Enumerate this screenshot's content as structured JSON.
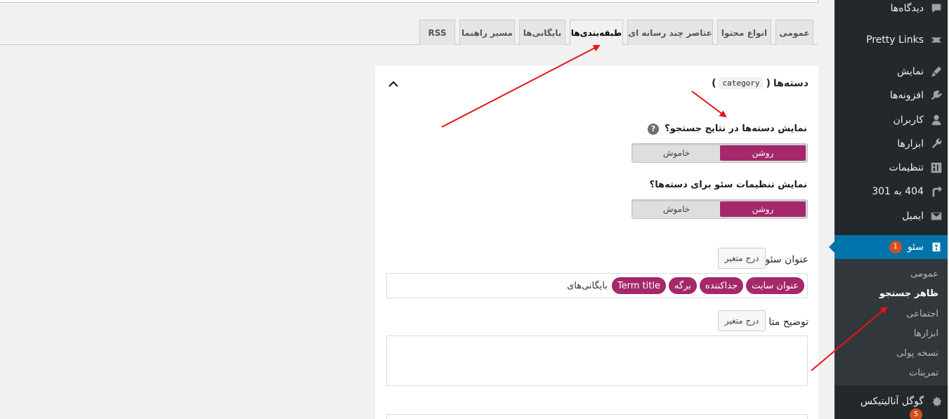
{
  "tabs": [
    {
      "label": "عمومی",
      "active": false
    },
    {
      "label": "انواع محتوا",
      "active": false
    },
    {
      "label": "عناصر چند رسانه ای",
      "active": false
    },
    {
      "label": "طبقه‌بندی‌ها",
      "active": true
    },
    {
      "label": "بایگانی‌ها",
      "active": false
    },
    {
      "label": "مسیر راهنما",
      "active": false
    },
    {
      "label": "RSS",
      "active": false
    }
  ],
  "panel": {
    "title": "دسته‌ها",
    "taxonomy_slug": "category",
    "show_in_search": {
      "label": "نمایش دسته‌ها در نتایج جستجو؟",
      "help": "?",
      "on_label": "روشن",
      "off_label": "خاموش",
      "value": "on"
    },
    "show_seo_settings": {
      "label": "نمایش تنظیمات سئو برای دسته‌ها؟",
      "on_label": "روشن",
      "off_label": "خاموش",
      "value": "on"
    },
    "seo_title": {
      "label": "عنوان سئو",
      "insert_button": "درج متغیر",
      "pills": [
        "عنوان سایت",
        "جداکننده",
        "برگه",
        "Term title"
      ],
      "trailing_text": "بایگانی‌های"
    },
    "meta_description": {
      "label": "توضیح متا",
      "insert_button": "درج متغیر",
      "value": ""
    }
  },
  "sidebar": {
    "items": [
      {
        "label": "دیدگاه‌ها",
        "icon": "comment-icon"
      },
      {
        "label": "Pretty Links",
        "icon": "pretty-links-icon"
      },
      {
        "label": "نمایش",
        "icon": "appearance-brush-icon"
      },
      {
        "label": "افزونه‌ها",
        "icon": "plugins-icon"
      },
      {
        "label": "کاربران",
        "icon": "users-icon"
      },
      {
        "label": "ابزارها",
        "icon": "tools-wrench-icon"
      },
      {
        "label": "تنظیمات",
        "icon": "settings-icon"
      },
      {
        "label": "404 به 301",
        "icon": "redirect-icon"
      },
      {
        "label": "ایمیل",
        "icon": "email-icon"
      },
      {
        "label": "سئو",
        "icon": "yoast-icon",
        "badge": "1",
        "active": true
      },
      {
        "label": "گوگل آنالیتیکس",
        "icon": "analytics-icon",
        "badge": "5"
      }
    ],
    "submenu": [
      {
        "label": "عمومی",
        "current": false
      },
      {
        "label": "ظاهر جستجو",
        "current": true
      },
      {
        "label": "اجتماعی",
        "current": false
      },
      {
        "label": "ابزارها",
        "current": false
      },
      {
        "label": "نسخه پولی",
        "current": false
      },
      {
        "label": "تمرینات",
        "current": false
      }
    ]
  },
  "colors": {
    "accent": "#a4286a",
    "admin_blue": "#0073aa",
    "sidebar_bg": "#23282d",
    "annotation_arrow": "#e8141a"
  }
}
